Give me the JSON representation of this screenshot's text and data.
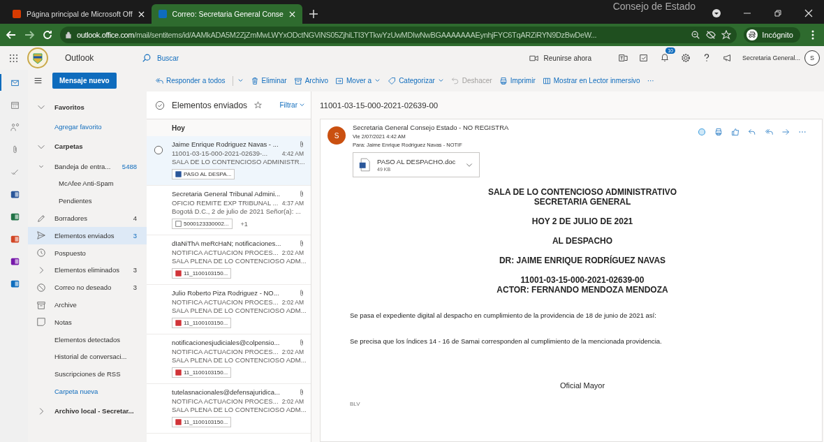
{
  "overlay_text": "Consejo de Estado",
  "browser": {
    "tabs": [
      {
        "title": "Página principal de Microsoft Off",
        "selected": false
      },
      {
        "title": "Correo: Secretaria General Conse",
        "selected": true
      }
    ],
    "url": "**outlook.office.com**/mail/sentitems/id/AAMkADA5M2ZjZmMwLWYxODctNGViNS05ZjhiLTI3YTkwYzUwMDIwNwBGAAAAAAAEynhjFYC6TqARZiRYN9DzBwDeW...",
    "profile": "Incógnito"
  },
  "header": {
    "app": "Outlook",
    "search_placeholder": "Buscar",
    "meet": "Reunirse ahora",
    "notifications": "10",
    "account": "Secretaria General...",
    "avatar": "S"
  },
  "new_message": "Mensaje nuevo",
  "toolbar": [
    {
      "label": "Responder a todos",
      "caret": true,
      "disabled": false
    },
    {
      "label": "Eliminar",
      "caret": false,
      "disabled": false
    },
    {
      "label": "Archivo",
      "caret": false,
      "disabled": false
    },
    {
      "label": "Mover a",
      "caret": true,
      "disabled": false
    },
    {
      "label": "Categorizar",
      "caret": true,
      "disabled": false
    },
    {
      "label": "Deshacer",
      "caret": false,
      "disabled": true
    },
    {
      "label": "Imprimir",
      "caret": false,
      "disabled": false
    },
    {
      "label": "Mostrar en Lector inmersivo",
      "caret": false,
      "disabled": false
    },
    {
      "label": "···",
      "caret": false,
      "disabled": false
    }
  ],
  "rail": [
    {
      "selected": true
    },
    {
      "selected": false
    },
    {
      "selected": false
    },
    {
      "selected": false
    },
    {
      "selected": false
    },
    {
      "selected": false
    },
    {
      "selected": false
    },
    {
      "selected": false
    },
    {
      "selected": false
    },
    {
      "selected": false
    }
  ],
  "folders": [
    {
      "label": "Favoritos",
      "kind": "section",
      "selected": false
    },
    {
      "label": "Agregar favorito",
      "kind": "link",
      "selected": false
    },
    {
      "label": "Carpetas",
      "kind": "section",
      "selected": false
    },
    {
      "label": "Bandeja de entra...",
      "count": "5488",
      "kind": "folder",
      "selected": false
    },
    {
      "label": "McAfee Anti-Spam",
      "kind": "subfolder",
      "selected": false
    },
    {
      "label": "Pendientes",
      "kind": "subfolder",
      "selected": false
    },
    {
      "label": "Borradores",
      "count": "4",
      "kind": "folder",
      "selected": false
    },
    {
      "label": "Elementos enviados",
      "count": "3",
      "kind": "folder",
      "selected": true
    },
    {
      "label": "Pospuesto",
      "kind": "folder",
      "selected": false
    },
    {
      "label": "Elementos eliminados",
      "count": "3",
      "kind": "folder",
      "selected": false
    },
    {
      "label": "Correo no deseado",
      "count": "3",
      "kind": "folder",
      "selected": false
    },
    {
      "label": "Archive",
      "kind": "folder",
      "selected": false
    },
    {
      "label": "Notas",
      "kind": "folder",
      "selected": false
    },
    {
      "label": "Elementos detectados",
      "kind": "folder",
      "selected": false
    },
    {
      "label": "Historial de conversaci...",
      "kind": "folder",
      "selected": false
    },
    {
      "label": "Suscripciones de RSS",
      "kind": "folder",
      "selected": false
    },
    {
      "label": "Carpeta nueva",
      "kind": "link",
      "selected": false
    },
    {
      "label": "Archivo local - Secretar...",
      "kind": "section",
      "selected": false
    }
  ],
  "list": {
    "title": "Elementos enviados",
    "filter": "Filtrar",
    "group": "Hoy",
    "messages": [
      {
        "sender": "Jaime Enrique Rodriguez Navas - ...",
        "subject": "11001-03-15-000-2021-02639-...",
        "time": "4:42 AM",
        "preview": "SALA DE LO CONTENCIOSO ADMINISTR...",
        "attachment": "PASO AL DESPA...",
        "kind": "word",
        "selected": true
      },
      {
        "sender": "Secretaria General Tribunal Admini...",
        "subject": "OFICIO REMITE EXP TRIBUNAL ...",
        "time": "4:37 AM",
        "preview": "Bogotá D.C., 2 de julio de 2021 Señor(a): ...",
        "attachment": "5000123330002...",
        "extra": "+1",
        "kind": "image",
        "selected": false
      },
      {
        "sender": "dIaNiThA meRcHaN; notificaciones...",
        "subject": "NOTIFICA ACTUACION PROCES...",
        "time": "2:02 AM",
        "preview": "SALA PLENA DE LO CONTENCIOSO ADM...",
        "attachment": "11_1100103150...",
        "kind": "pdf",
        "selected": false
      },
      {
        "sender": "Julio Roberto Piza Rodriguez - NO...",
        "subject": "NOTIFICA ACTUACION PROCES...",
        "time": "2:02 AM",
        "preview": "SALA PLENA DE LO CONTENCIOSO ADM...",
        "attachment": "11_1100103150...",
        "kind": "pdf",
        "selected": false
      },
      {
        "sender": "notificacionesjudiciales@colpensio...",
        "subject": "NOTIFICA ACTUACION PROCES...",
        "time": "2:02 AM",
        "preview": "SALA PLENA DE LO CONTENCIOSO ADM...",
        "attachment": "11_1100103150...",
        "kind": "pdf",
        "selected": false
      },
      {
        "sender": "tutelasnacionales@defensajuridica...",
        "subject": "NOTIFICA ACTUACION PROCES...",
        "time": "2:02 AM",
        "preview": "SALA PLENA DE LO CONTENCIOSO ADM...",
        "attachment": "11_1100103150...",
        "kind": "pdf",
        "selected": false
      }
    ]
  },
  "reading": {
    "subject": "11001-03-15-000-2021-02639-00",
    "avatar": "S",
    "from": "Secretaria General Consejo Estado - NO REGISTRA",
    "date": "Vie 2/07/2021 4:42 AM",
    "to_label": "Para:",
    "to": "Jaime Enrique Rodriguez Navas - NOTIF",
    "attachment": {
      "name": "PASO AL DESPACHO.doc",
      "size": "49 KB"
    },
    "body": [
      {
        "kind": "heading",
        "lines": [
          "SALA DE LO CONTENCIOSO ADMINISTRATIVO",
          "SECRETARIA GENERAL"
        ]
      },
      {
        "kind": "heading",
        "lines": [
          "HOY 2 DE JULIO DE 2021"
        ]
      },
      {
        "kind": "heading",
        "lines": [
          "AL DESPACHO"
        ]
      },
      {
        "kind": "heading",
        "lines": [
          "DR:  JAIME ENRIQUE RODRÍGUEZ NAVAS"
        ]
      },
      {
        "kind": "heading",
        "lines": [
          "11001-03-15-000-2021-02639-00",
          "ACTOR:  FERNANDO MENDOZA MENDOZA"
        ]
      },
      {
        "kind": "paragraph",
        "lines": [
          "Se pasa el expediente digital al despacho en cumplimiento de la providencia de 18 de junio de 2021 así:"
        ]
      },
      {
        "kind": "paragraph",
        "lines": [
          "Se precisa que los índices 14 - 16 de Samai corresponden al cumplimiento de la mencionada providencia."
        ]
      },
      {
        "kind": "signature",
        "lines": [
          "Oficial Mayor"
        ]
      },
      {
        "kind": "initials",
        "lines": [
          "BLV"
        ]
      }
    ]
  }
}
